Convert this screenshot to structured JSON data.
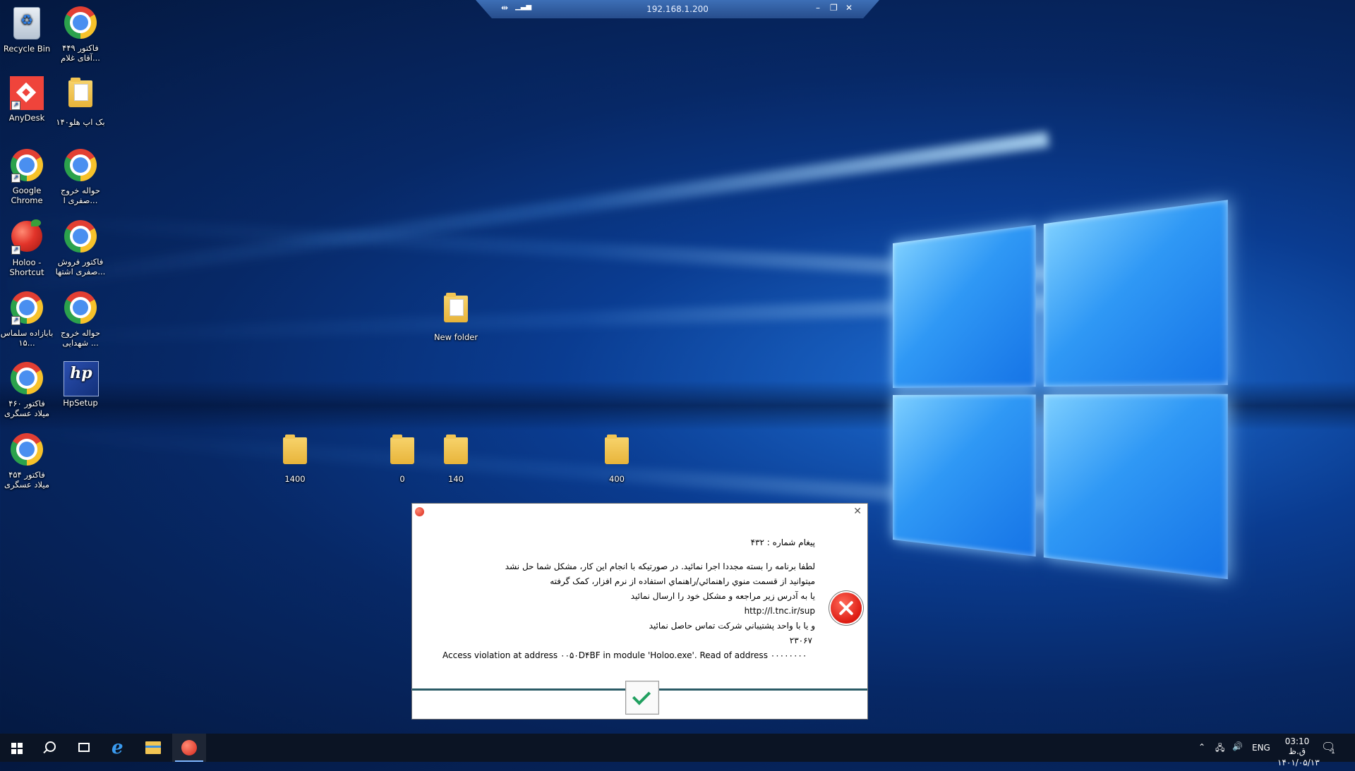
{
  "remote_bar": {
    "title": "192.168.1.200"
  },
  "desktop": {
    "icons": [
      {
        "label": "Recycle Bin"
      },
      {
        "label": "فاکتور ۴۴۹ آقای غلام..."
      },
      {
        "label": "AnyDesk"
      },
      {
        "label": "بک اپ هلو۱۴۰"
      },
      {
        "label": "Google Chrome"
      },
      {
        "label": "حواله خروج صفری ا..."
      },
      {
        "label": "Holoo - Shortcut"
      },
      {
        "label": "فاکتور فروش صفری اشتها..."
      },
      {
        "label": "بابازاده سلماس ۱۵..."
      },
      {
        "label": "حواله خروج شهدایی ..."
      },
      {
        "label": "فاکتور ۴۶۰ میلاد عسگری"
      },
      {
        "label": "HpSetup"
      },
      {
        "label": "فاکتور ۴۵۴ میلاد عسگری"
      },
      {
        "label": "New folder"
      },
      {
        "label": "1400"
      },
      {
        "label": "0"
      },
      {
        "label": "140"
      },
      {
        "label": "400"
      }
    ]
  },
  "dialog": {
    "message_number": "پیغام شماره : ۴۳۲",
    "lines": [
      "لطفا برنامه را بسته مجددا اجرا نمائید. در صورتیکه با انجام این کار، مشکل شما حل نشد",
      "ميتوانيد از قسمت منوي راهنمائي/راهنماي استفاده از نرم افزار، کمک گرفته",
      "یا به آدرس زیر مراجعه و مشکل خود را ارسال نمائید",
      "http://l.tnc.ir/sup",
      "و یا با واحد پشتيباني شركت تماس حاصل نمائید",
      "۲۳۰۶۷"
    ],
    "error_detail": "Access violation at address ۰۰۵۰D۴BF in module 'Holoo.exe'. Read of address ۰۰۰۰۰۰۰۰"
  },
  "taskbar": {
    "language": "ENG",
    "time": "03:10 ق.ظ",
    "date": "۱۴۰۱/۰۵/۱۳",
    "notification_count": "1"
  },
  "colors": {
    "taskbar_bg": "#0b1424",
    "dialog_separator": "#2b5b66",
    "ok_check": "#21a060",
    "error_red": "#dd1b12"
  }
}
